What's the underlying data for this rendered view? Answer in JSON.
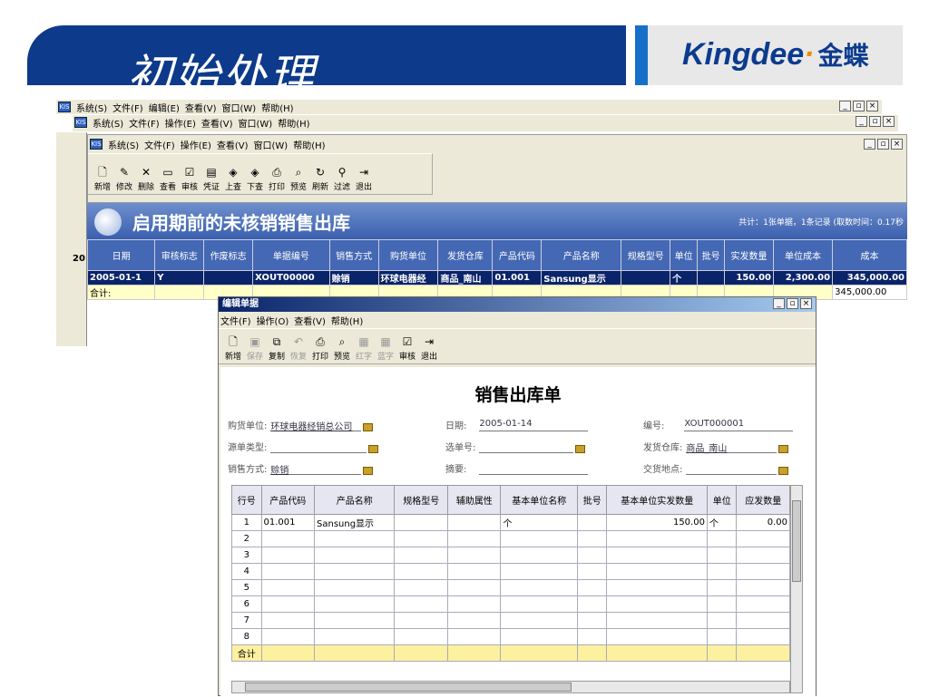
{
  "slide": {
    "title": "初始处理",
    "brand": {
      "name_a": "Kingd",
      "name_b": "ee",
      "dot": "·",
      "cn": "金蝶"
    }
  },
  "app_menus": {
    "outer": [
      "系统(S)",
      "文件(F)",
      "编辑(E)",
      "查看(V)",
      "窗口(W)",
      "帮助(H)"
    ],
    "middle": [
      "系统(S)",
      "文件(F)",
      "操作(E)",
      "查看(V)",
      "窗口(W)",
      "帮助(H)"
    ],
    "inner": [
      "系统(S)",
      "文件(F)",
      "操作(E)",
      "查看(V)",
      "窗口(W)",
      "帮助(H)"
    ]
  },
  "report_toolbar": [
    {
      "label": "新增",
      "icon": "new-icon"
    },
    {
      "label": "修改",
      "icon": "edit-icon"
    },
    {
      "label": "删除",
      "icon": "delete-icon"
    },
    {
      "label": "查看",
      "icon": "view-icon"
    },
    {
      "label": "审核",
      "icon": "audit-icon"
    },
    {
      "label": "凭证",
      "icon": "voucher-icon"
    },
    {
      "label": "上查",
      "icon": "up-icon"
    },
    {
      "label": "下查",
      "icon": "down-icon"
    },
    {
      "label": "打印",
      "icon": "print-icon"
    },
    {
      "label": "预览",
      "icon": "preview-icon"
    },
    {
      "label": "刷新",
      "icon": "refresh-icon"
    },
    {
      "label": "过滤",
      "icon": "filter-icon"
    },
    {
      "label": "退出",
      "icon": "exit-icon"
    }
  ],
  "report": {
    "title": "启用期前的未核销销售出库",
    "summary": "共计：1张单据，1条记录 (取数时间：0.17秒",
    "left_marker": "20",
    "columns": [
      "日期",
      "审核标志",
      "作废标志",
      "单据编号",
      "销售方式",
      "购货单位",
      "发货仓库",
      "产品代码",
      "产品名称",
      "规格型号",
      "单位",
      "批号",
      "实发数量",
      "单位成本",
      "成本"
    ],
    "row": [
      "2005-01-1",
      "Y",
      "",
      "XOUT00000",
      "赊销",
      "环球电器经",
      "商品_南山",
      "01.001",
      "Sansung显示",
      "",
      "个",
      "",
      "150.00",
      "2,300.00",
      "345,000.00"
    ],
    "total_label": "合计:",
    "total_value": "345,000.00"
  },
  "dialog": {
    "title": "编辑单据",
    "menus": [
      "文件(F)",
      "操作(O)",
      "查看(V)",
      "帮助(H)"
    ],
    "toolbar": [
      {
        "label": "新增",
        "icon": "new-icon",
        "on": true
      },
      {
        "label": "保存",
        "icon": "save-icon",
        "on": false
      },
      {
        "label": "复制",
        "icon": "copy-icon",
        "on": true
      },
      {
        "label": "恢复",
        "icon": "undo-icon",
        "on": false
      },
      {
        "label": "打印",
        "icon": "print-icon",
        "on": true
      },
      {
        "label": "预览",
        "icon": "preview-icon",
        "on": true
      },
      {
        "label": "红字",
        "icon": "red-icon",
        "on": false
      },
      {
        "label": "蓝字",
        "icon": "blue-icon",
        "on": false
      },
      {
        "label": "审核",
        "icon": "audit-icon",
        "on": true
      },
      {
        "label": "退出",
        "icon": "exit-icon",
        "on": true
      }
    ],
    "doc_title": "销售出库单",
    "fields": {
      "buyer_label": "购货单位:",
      "buyer": "环球电器经销总公司",
      "date_label": "日期:",
      "date": "2005-01-14",
      "no_label": "编号:",
      "no": "XOUT000001",
      "src_label": "源单类型:",
      "src": "",
      "sel_label": "选单号:",
      "sel": "",
      "wh_label": "发货仓库:",
      "wh": "商品_南山",
      "method_label": "销售方式:",
      "method": "赊销",
      "memo_label": "摘要:",
      "memo": "",
      "place_label": "交货地点:",
      "place": ""
    },
    "grid_columns": [
      "行号",
      "产品代码",
      "产品名称",
      "规格型号",
      "辅助属性",
      "基本单位名称",
      "批号",
      "基本单位实发数量",
      "单位",
      "应发数量"
    ],
    "grid_rows": [
      [
        "1",
        "01.001",
        "Sansung显示",
        "",
        "",
        "个",
        "",
        "150.00",
        "个",
        "0.00"
      ],
      [
        "2",
        "",
        "",
        "",
        "",
        "",
        "",
        "",
        "",
        ""
      ],
      [
        "3",
        "",
        "",
        "",
        "",
        "",
        "",
        "",
        "",
        ""
      ],
      [
        "4",
        "",
        "",
        "",
        "",
        "",
        "",
        "",
        "",
        ""
      ],
      [
        "5",
        "",
        "",
        "",
        "",
        "",
        "",
        "",
        "",
        ""
      ],
      [
        "6",
        "",
        "",
        "",
        "",
        "",
        "",
        "",
        "",
        ""
      ],
      [
        "7",
        "",
        "",
        "",
        "",
        "",
        "",
        "",
        "",
        ""
      ],
      [
        "8",
        "",
        "",
        "",
        "",
        "",
        "",
        "",
        "",
        ""
      ]
    ],
    "grid_total": "合计"
  }
}
